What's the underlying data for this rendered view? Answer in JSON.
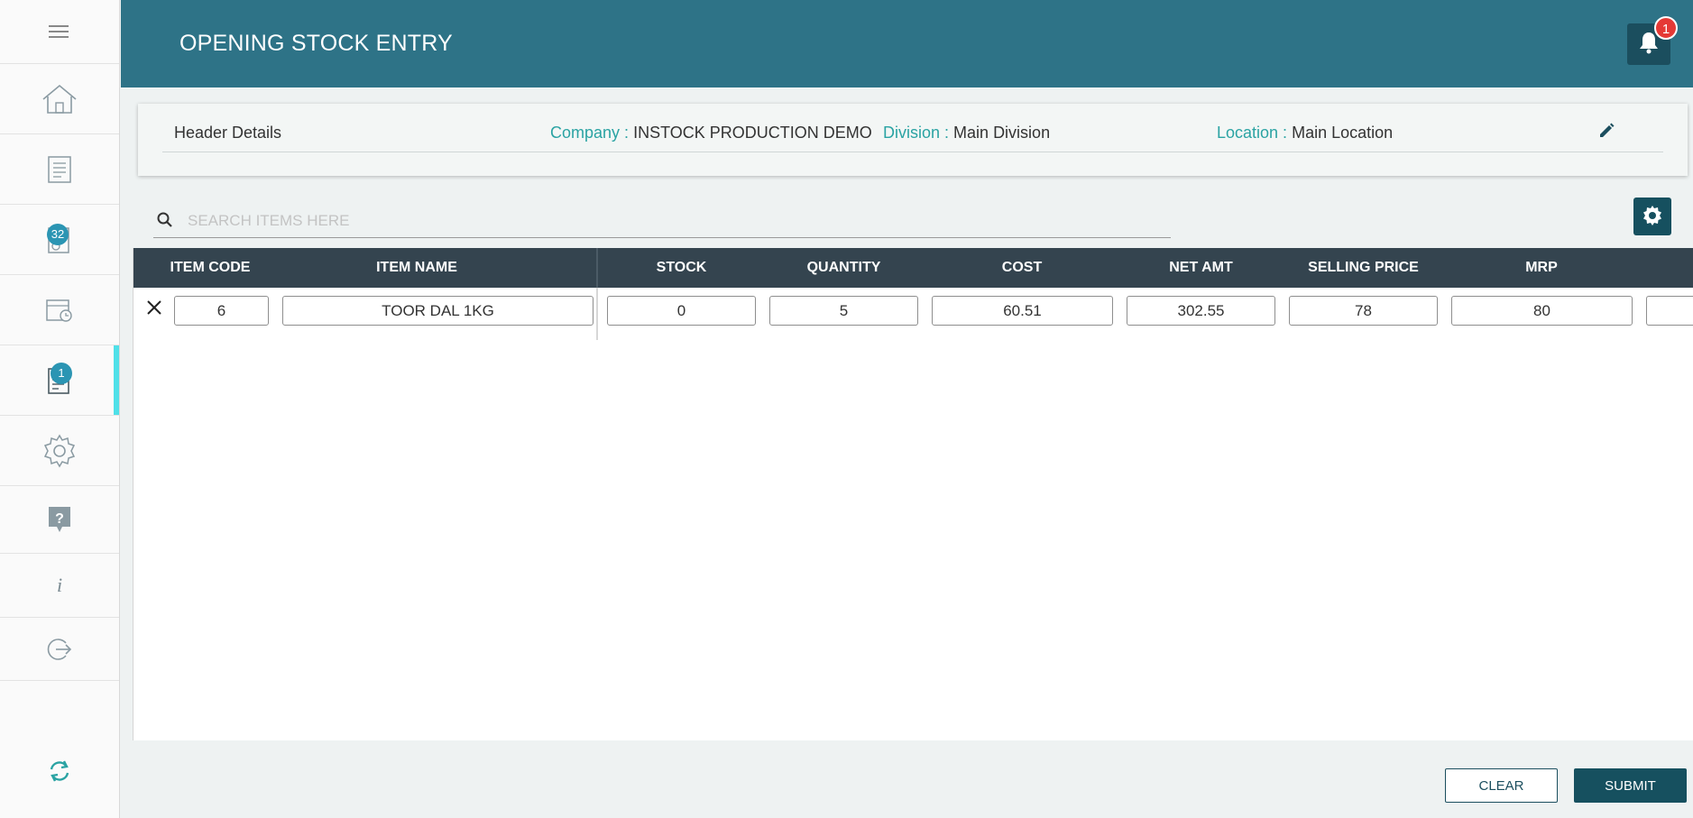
{
  "header": {
    "title": "OPENING STOCK ENTRY",
    "notification_count": "1"
  },
  "sidebar": {
    "items": [
      {
        "icon": "menu-icon"
      },
      {
        "icon": "home-icon"
      },
      {
        "icon": "document-icon"
      },
      {
        "icon": "calculator-report-icon",
        "badge": "32"
      },
      {
        "icon": "stock-box-icon"
      },
      {
        "icon": "stock-entry-icon",
        "badge": "1",
        "active": true
      },
      {
        "icon": "gear-icon"
      },
      {
        "icon": "help-icon"
      },
      {
        "icon": "info-icon",
        "glyph": "i"
      },
      {
        "icon": "logout-icon"
      },
      {
        "icon": "sync-icon"
      }
    ]
  },
  "header_details": {
    "label": "Header Details",
    "company_key": "Company :",
    "company_value": "INSTOCK PRODUCTION DEMO",
    "division_key": "Division :",
    "division_value": "Main Division",
    "location_key": "Location :",
    "location_value": "Main Location"
  },
  "search": {
    "placeholder": "SEARCH ITEMS HERE",
    "value": ""
  },
  "table": {
    "columns": [
      "ITEM CODE",
      "ITEM NAME",
      "STOCK",
      "QUANTITY",
      "COST",
      "NET AMT",
      "SELLING PRICE",
      "MRP"
    ],
    "rows": [
      {
        "item_code": "6",
        "item_name": "TOOR DAL 1KG",
        "stock": "0",
        "quantity": "5",
        "cost": "60.51",
        "net_amt": "302.55",
        "selling_price": "78",
        "mrp": "80"
      }
    ]
  },
  "footer": {
    "clear_label": "CLEAR",
    "submit_label": "SUBMIT"
  },
  "colors": {
    "header": "#2e7387",
    "dark": "#16505f",
    "accent": "#2aa3a3",
    "badge": "#2b95b3",
    "alert": "#e53935",
    "active_indicator": "#4fe0e8"
  }
}
